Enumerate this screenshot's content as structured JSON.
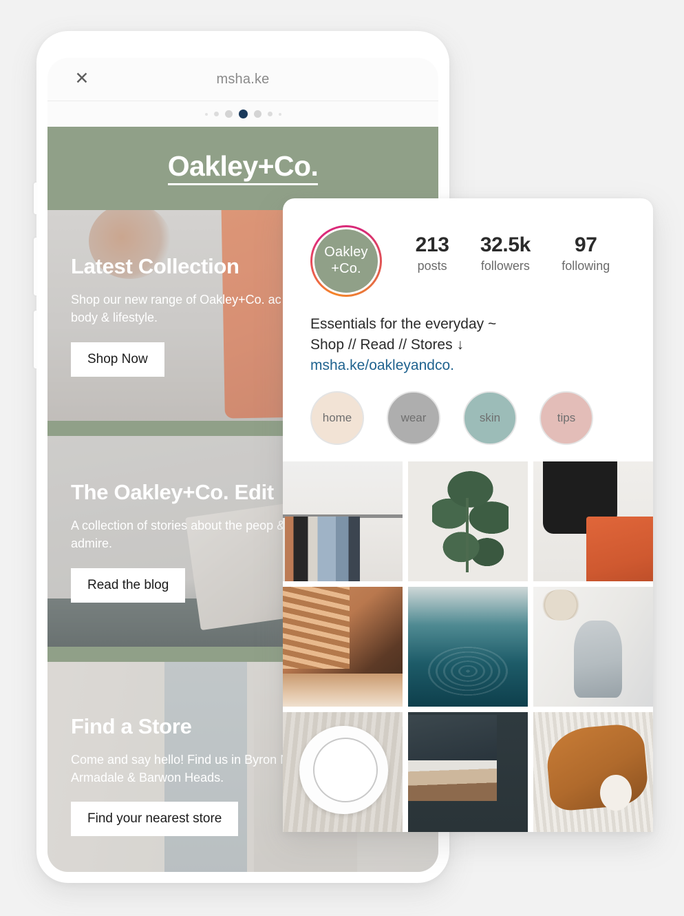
{
  "browser": {
    "close_icon": "close-icon",
    "url": "msha.ke",
    "page_dots": 7,
    "active_dot_index": 3,
    "active_dot_color": "#1a3a5c",
    "inactive_dot_color": "#d7d7d7"
  },
  "site": {
    "brand_title": "Oakley+Co.",
    "brand_bar_color": "#90a088",
    "sections": [
      {
        "heading": "Latest Collection",
        "body": "Shop our new range of Oakley+Co. ac for home, body & lifestyle.",
        "button": "Shop Now",
        "media": "orange-tote-bag-photo"
      },
      {
        "heading": "The Oakley+Co. Edit",
        "body": "A collection of stories about the peop & places we admire.",
        "button": "Read the blog",
        "media": "books-and-glasses-photo"
      },
      {
        "heading": "Find a Store",
        "body": "Come and say hello! Find us in Byron Noosa, Armadale & Barwon Heads.",
        "button": "Find your nearest store",
        "media": "folded-linens-photo"
      }
    ]
  },
  "instagram": {
    "avatar": {
      "line1": "Oakley",
      "line2": "+Co.",
      "fill_color": "#90a088",
      "ring_gradient_start": "#f58529",
      "ring_gradient_end": "#dd2a7b"
    },
    "stats": [
      {
        "value": "213",
        "label": "posts"
      },
      {
        "value": "32.5k",
        "label": "followers"
      },
      {
        "value": "97",
        "label": "following"
      }
    ],
    "bio": {
      "line1": "Essentials for the everyday ~",
      "line2": "Shop // Read // Stores ↓",
      "link": "msha.ke/oakleyandco.",
      "link_color": "#20638f"
    },
    "highlights": [
      {
        "label": "home",
        "color": "#f2e3d5"
      },
      {
        "label": "wear",
        "color": "#aeaeae"
      },
      {
        "label": "skin",
        "color": "#9cbcb8"
      },
      {
        "label": "tips",
        "color": "#e3bdb8"
      }
    ],
    "grid": [
      {
        "alt": "clothing-rack-with-hat"
      },
      {
        "alt": "rubber-plant-leaves"
      },
      {
        "alt": "person-holding-orange-tote-bag"
      },
      {
        "alt": "sunlit-bedroom-with-blinds"
      },
      {
        "alt": "dark-teal-water-ripples"
      },
      {
        "alt": "linen-robe-on-white-wall"
      },
      {
        "alt": "white-plates-on-linen"
      },
      {
        "alt": "folded-textiles-on-dark-background"
      },
      {
        "alt": "brown-dog-resting-on-bed"
      }
    ]
  }
}
